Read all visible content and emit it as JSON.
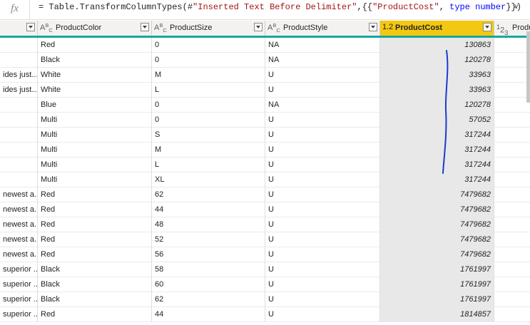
{
  "formula": {
    "fx": "fx",
    "p1": "= Table.TransformColumnTypes(#",
    "s1": "\"Inserted Text Before Delimiter\"",
    "p2": ",{{",
    "s2": "\"ProductCost\"",
    "p3": ", ",
    "kw": "type number",
    "p4": "}})"
  },
  "columns": [
    {
      "type_icon": "",
      "label": ""
    },
    {
      "type_icon": "ABC",
      "label": "ProductColor"
    },
    {
      "type_icon": "ABC",
      "label": "ProductSize"
    },
    {
      "type_icon": "ABC",
      "label": "ProductStyle"
    },
    {
      "type_icon": "1.2",
      "label": "ProductCost"
    },
    {
      "type_icon": "123",
      "label": "Product"
    }
  ],
  "rows": [
    {
      "c0": "",
      "color": "Red",
      "size": "0",
      "style": "NA",
      "cost": "130863"
    },
    {
      "c0": "",
      "color": "Black",
      "size": "0",
      "style": "NA",
      "cost": "120278"
    },
    {
      "c0": "ides just...",
      "color": "White",
      "size": "M",
      "style": "U",
      "cost": "33963"
    },
    {
      "c0": "ides just...",
      "color": "White",
      "size": "L",
      "style": "U",
      "cost": "33963"
    },
    {
      "c0": "",
      "color": "Blue",
      "size": "0",
      "style": "NA",
      "cost": "120278"
    },
    {
      "c0": "",
      "color": "Multi",
      "size": "0",
      "style": "U",
      "cost": "57052"
    },
    {
      "c0": "",
      "color": "Multi",
      "size": "S",
      "style": "U",
      "cost": "317244"
    },
    {
      "c0": "",
      "color": "Multi",
      "size": "M",
      "style": "U",
      "cost": "317244"
    },
    {
      "c0": "",
      "color": "Multi",
      "size": "L",
      "style": "U",
      "cost": "317244"
    },
    {
      "c0": "",
      "color": "Multi",
      "size": "XL",
      "style": "U",
      "cost": "317244"
    },
    {
      "c0": "newest a...",
      "color": "Red",
      "size": "62",
      "style": "U",
      "cost": "7479682"
    },
    {
      "c0": "newest a...",
      "color": "Red",
      "size": "44",
      "style": "U",
      "cost": "7479682"
    },
    {
      "c0": "newest a...",
      "color": "Red",
      "size": "48",
      "style": "U",
      "cost": "7479682"
    },
    {
      "c0": "newest a...",
      "color": "Red",
      "size": "52",
      "style": "U",
      "cost": "7479682"
    },
    {
      "c0": "newest a...",
      "color": "Red",
      "size": "56",
      "style": "U",
      "cost": "7479682"
    },
    {
      "c0": "superior ...",
      "color": "Black",
      "size": "58",
      "style": "U",
      "cost": "1761997"
    },
    {
      "c0": "superior ...",
      "color": "Black",
      "size": "60",
      "style": "U",
      "cost": "1761997"
    },
    {
      "c0": "superior ...",
      "color": "Black",
      "size": "62",
      "style": "U",
      "cost": "1761997"
    },
    {
      "c0": "superior ...",
      "color": "Red",
      "size": "44",
      "style": "U",
      "cost": "1814857"
    }
  ],
  "colors": {
    "selected_header": "#f2c811",
    "accent_line": "#13a89e",
    "annotation": "#1a3ccf"
  }
}
